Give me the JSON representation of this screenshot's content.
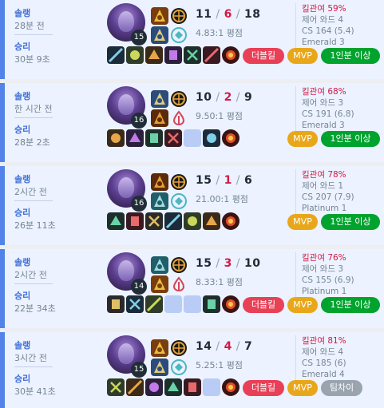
{
  "games": [
    {
      "queue": "솔랭",
      "time_ago": "28분 전",
      "result": "승리",
      "duration": "30분 9초",
      "level": "15",
      "kills": "11",
      "deaths": "6",
      "assists": "18",
      "ratio": "4.83:1 평점",
      "kill_participation": "킬관여 59%",
      "control_wards": "제어 와드 4",
      "cs": "CS 164 (5.4)",
      "rank": "Emerald 3",
      "items": [
        "item-icon",
        "item-icon",
        "item-icon",
        "item-icon",
        "item-icon",
        "item-icon",
        "trinket-icon"
      ],
      "badges": [
        {
          "label": "더블킬",
          "color": "#e84057"
        },
        {
          "label": "MVP",
          "color": "#e8a71a"
        },
        {
          "label": "1인분 이상",
          "color": "#00a32e"
        }
      ]
    },
    {
      "queue": "솔랭",
      "time_ago": "한 시간 전",
      "result": "승리",
      "duration": "28분 2초",
      "level": "16",
      "kills": "10",
      "deaths": "2",
      "assists": "9",
      "ratio": "9.50:1 평점",
      "kill_participation": "킬관여 68%",
      "control_wards": "제어 와드 3",
      "cs": "CS 191 (6.8)",
      "rank": "Emerald 3",
      "items": [
        "item-icon",
        "item-icon",
        "item-icon",
        "item-icon",
        "empty",
        "item-icon",
        "trinket-icon"
      ],
      "badges": [
        {
          "label": "MVP",
          "color": "#e8a71a"
        },
        {
          "label": "1인분 이상",
          "color": "#00a32e"
        }
      ]
    },
    {
      "queue": "솔랭",
      "time_ago": "2시간 전",
      "result": "승리",
      "duration": "26분 11초",
      "level": "16",
      "kills": "15",
      "deaths": "1",
      "assists": "6",
      "ratio": "21.00:1 평점",
      "kill_participation": "킬관여 78%",
      "control_wards": "제어 와드 1",
      "cs": "CS 207 (7.9)",
      "rank": "Platinum 1",
      "items": [
        "item-icon",
        "item-icon",
        "item-icon",
        "item-icon",
        "item-icon",
        "item-icon",
        "trinket-icon"
      ],
      "badges": [
        {
          "label": "MVP",
          "color": "#e8a71a"
        },
        {
          "label": "1인분 이상",
          "color": "#00a32e"
        }
      ]
    },
    {
      "queue": "솔랭",
      "time_ago": "2시간 전",
      "result": "승리",
      "duration": "22분 34초",
      "level": "14",
      "kills": "15",
      "deaths": "3",
      "assists": "10",
      "ratio": "8.33:1 평점",
      "kill_participation": "킬관여 76%",
      "control_wards": "제어 와드 3",
      "cs": "CS 155 (6.9)",
      "rank": "Platinum 1",
      "items": [
        "item-icon",
        "item-icon",
        "item-icon",
        "empty",
        "empty",
        "item-icon",
        "trinket-icon"
      ],
      "badges": [
        {
          "label": "더블킬",
          "color": "#e84057"
        },
        {
          "label": "MVP",
          "color": "#e8a71a"
        },
        {
          "label": "1인분 이상",
          "color": "#00a32e"
        }
      ]
    },
    {
      "queue": "솔랭",
      "time_ago": "3시간 전",
      "result": "승리",
      "duration": "30분 41초",
      "level": "15",
      "kills": "14",
      "deaths": "4",
      "assists": "7",
      "ratio": "5.25:1 평점",
      "kill_participation": "킬관여 81%",
      "control_wards": "제어 와드 4",
      "cs": "CS 185 (6)",
      "rank": "Emerald 4",
      "items": [
        "item-icon",
        "item-icon",
        "item-icon",
        "item-icon",
        "item-icon",
        "empty",
        "trinket-icon"
      ],
      "badges": [
        {
          "label": "더블킬",
          "color": "#e84057"
        },
        {
          "label": "MVP",
          "color": "#e8a71a"
        },
        {
          "label": "팀차이",
          "color": "#9aa4af"
        }
      ]
    }
  ],
  "colors": {
    "win_accent": "#5383e8",
    "card_bg": "#ecf2ff",
    "kp_red": "#d31a45"
  }
}
